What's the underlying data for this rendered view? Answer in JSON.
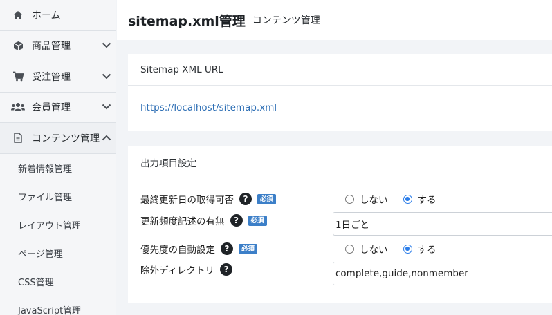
{
  "sidebar": {
    "items": [
      {
        "label": "ホーム",
        "icon": "home-icon"
      },
      {
        "label": "商品管理",
        "icon": "box-icon"
      },
      {
        "label": "受注管理",
        "icon": "cart-icon"
      },
      {
        "label": "会員管理",
        "icon": "users-icon"
      },
      {
        "label": "コンテンツ管理",
        "icon": "document-icon"
      }
    ],
    "sub_items": [
      {
        "label": "新着情報管理"
      },
      {
        "label": "ファイル管理"
      },
      {
        "label": "レイアウト管理"
      },
      {
        "label": "ページ管理"
      },
      {
        "label": "CSS管理"
      },
      {
        "label": "JavaScript管理"
      }
    ]
  },
  "header": {
    "title": "sitemap.xml管理",
    "subtitle": "コンテンツ管理"
  },
  "url_card": {
    "title": "Sitemap XML URL",
    "url": "https://localhost/sitemap.xml"
  },
  "settings_card": {
    "title": "出力項目設定",
    "required_label": "必須",
    "help_glyph": "?",
    "fields": {
      "lastmod": {
        "label": "最終更新日の取得可否",
        "options": [
          "しない",
          "する"
        ],
        "selected": "する"
      },
      "changefreq": {
        "label": "更新頻度記述の有無",
        "value": "1日ごと"
      },
      "priority": {
        "label": "優先度の自動設定",
        "options": [
          "しない",
          "する"
        ],
        "selected": "する"
      },
      "exclude": {
        "label": "除外ディレクトリ",
        "value": "complete,guide,nonmember"
      }
    }
  }
}
